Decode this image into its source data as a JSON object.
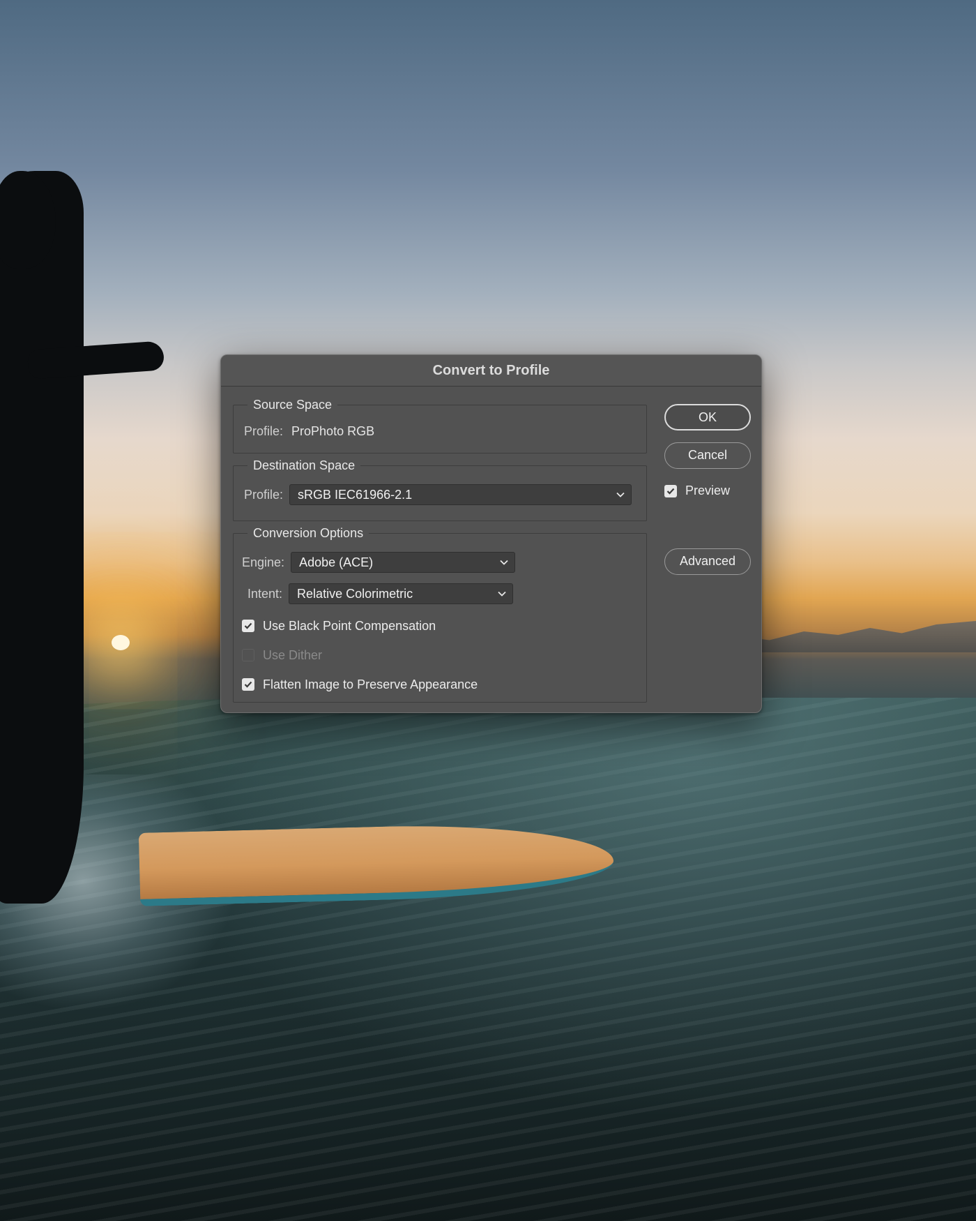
{
  "dialog": {
    "title": "Convert to Profile",
    "source_space": {
      "legend": "Source Space",
      "profile_label": "Profile:",
      "profile_value": "ProPhoto RGB"
    },
    "destination_space": {
      "legend": "Destination Space",
      "profile_label": "Profile:",
      "profile_selected": "sRGB IEC61966-2.1"
    },
    "conversion_options": {
      "legend": "Conversion Options",
      "engine_label": "Engine:",
      "engine_selected": "Adobe (ACE)",
      "intent_label": "Intent:",
      "intent_selected": "Relative Colorimetric",
      "black_point": {
        "label": "Use Black Point Compensation",
        "checked": true
      },
      "dither": {
        "label": "Use Dither",
        "checked": false,
        "enabled": false
      },
      "flatten": {
        "label": "Flatten Image to Preserve Appearance",
        "checked": true
      }
    },
    "buttons": {
      "ok": "OK",
      "cancel": "Cancel",
      "advanced": "Advanced"
    },
    "preview": {
      "label": "Preview",
      "checked": true
    }
  },
  "icons": {
    "chevron": "chevron-down-icon",
    "check": "checkmark-icon"
  },
  "colors": {
    "dialog_bg": "#525252",
    "field_bg": "#3e3e3e",
    "text": "#e6e6e6"
  }
}
